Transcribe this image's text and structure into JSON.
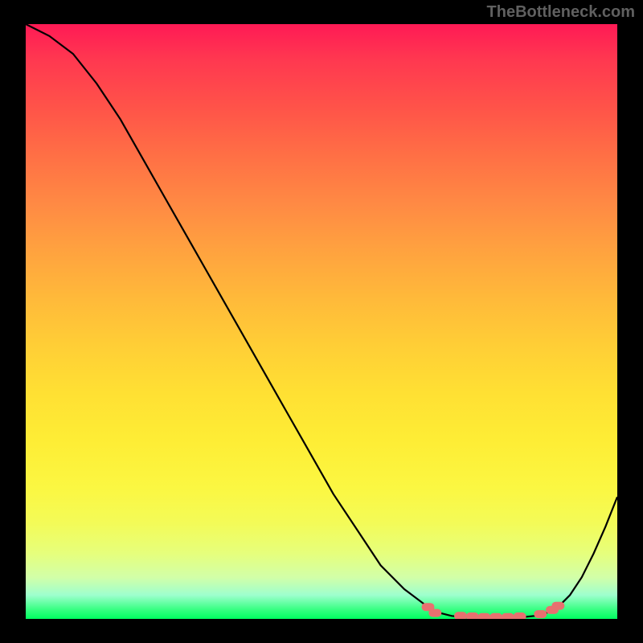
{
  "watermark": "TheBottleneck.com",
  "chart_data": {
    "type": "line",
    "title": "",
    "xlabel": "",
    "ylabel": "",
    "x": [
      0.0,
      0.04,
      0.08,
      0.12,
      0.16,
      0.2,
      0.24,
      0.28,
      0.32,
      0.36,
      0.4,
      0.44,
      0.48,
      0.52,
      0.56,
      0.6,
      0.64,
      0.68,
      0.7,
      0.72,
      0.74,
      0.76,
      0.78,
      0.8,
      0.82,
      0.84,
      0.86,
      0.88,
      0.9,
      0.92,
      0.94,
      0.96,
      0.98,
      1.0
    ],
    "series": [
      {
        "name": "curve",
        "values": [
          1.0,
          0.98,
          0.95,
          0.9,
          0.84,
          0.77,
          0.7,
          0.63,
          0.56,
          0.49,
          0.42,
          0.35,
          0.28,
          0.21,
          0.15,
          0.09,
          0.05,
          0.02,
          0.01,
          0.005,
          0.003,
          0.002,
          0.002,
          0.002,
          0.002,
          0.003,
          0.005,
          0.01,
          0.02,
          0.04,
          0.07,
          0.11,
          0.155,
          0.205
        ]
      }
    ],
    "markers": {
      "name": "highlighted-points",
      "x": [
        0.68,
        0.692,
        0.735,
        0.755,
        0.775,
        0.795,
        0.815,
        0.835,
        0.87,
        0.89,
        0.9
      ],
      "y": [
        0.02,
        0.01,
        0.005,
        0.004,
        0.003,
        0.003,
        0.003,
        0.004,
        0.008,
        0.015,
        0.022
      ]
    },
    "xlim": [
      0,
      1
    ],
    "ylim": [
      0,
      1
    ],
    "gradient_colors": {
      "top": "#ff1a55",
      "bottom": "#00ff60"
    },
    "marker_color": "#e8706f",
    "line_color": "#000000"
  }
}
